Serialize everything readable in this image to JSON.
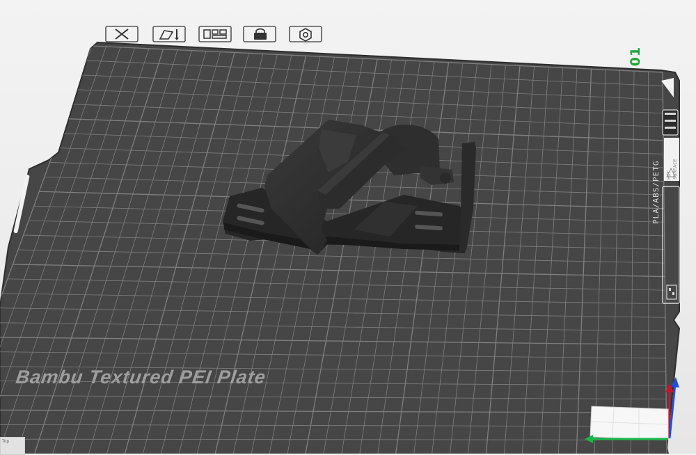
{
  "plate": {
    "number": "01",
    "name": "Bambu Textured PEI Plate",
    "materials": "PLA/ABS/PETG",
    "warning": [
      "HOT",
      "SURFACE"
    ]
  },
  "toolbar": {
    "buttons": [
      {
        "name": "remove-plate-button",
        "icon": "close-icon"
      },
      {
        "name": "auto-orient-button",
        "icon": "orient-icon"
      },
      {
        "name": "arrange-button",
        "icon": "arrange-icon"
      },
      {
        "name": "lock-plate-button",
        "icon": "lock-icon"
      },
      {
        "name": "plate-settings-button",
        "icon": "gear-icon"
      }
    ]
  },
  "corner": {
    "label": "Top"
  },
  "colors": {
    "plate": "#464646",
    "grid": "#8a8a8a",
    "accent_green": "#1fa53a",
    "axis_x": "#19b84a",
    "axis_y": "#1f4fd9",
    "axis_z": "#c2182c"
  }
}
